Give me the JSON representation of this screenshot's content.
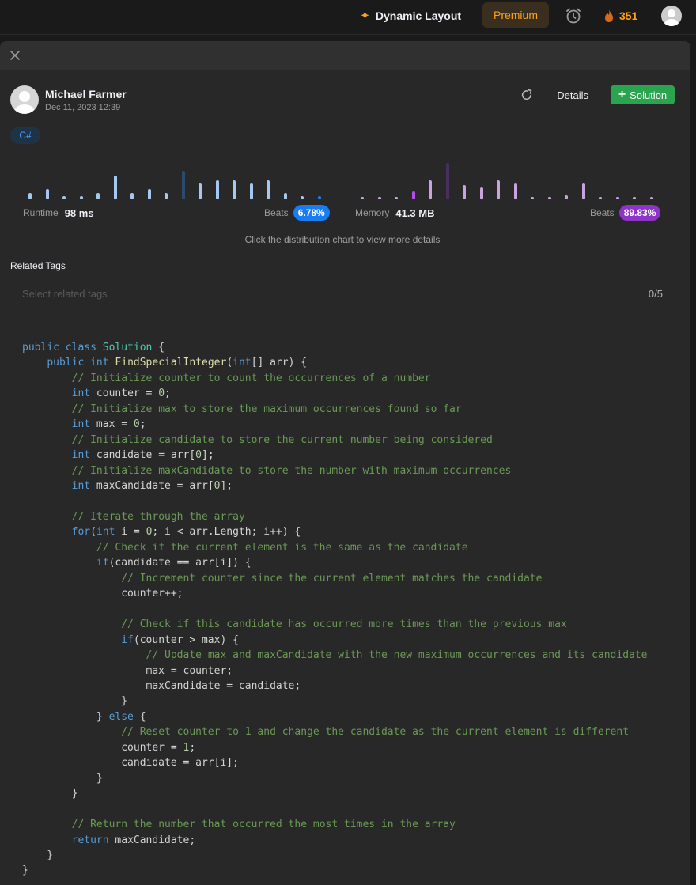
{
  "topbar": {
    "dynamic_layout": "Dynamic Layout",
    "premium": "Premium",
    "streak": "351"
  },
  "submission": {
    "author": "Michael Farmer",
    "date": "Dec 11, 2023 12:39",
    "details_label": "Details",
    "solution_label": "Solution",
    "language": "C#"
  },
  "runtime": {
    "label": "Runtime",
    "value": "98 ms",
    "beats_label": "Beats",
    "beats": "6.78%",
    "accent": "#1a7cf1"
  },
  "memory": {
    "label": "Memory",
    "value": "41.3 MB",
    "beats_label": "Beats",
    "beats": "89.83%",
    "accent": "#8e35c8"
  },
  "hint": "Click the distribution chart to view more details",
  "related_tags": {
    "label": "Related Tags",
    "placeholder": "Select related tags",
    "count": "0/5"
  },
  "code": [
    "public class Solution {",
    "    public int FindSpecialInteger(int[] arr) {",
    "        // Initialize counter to count the occurrences of a number",
    "        int counter = 0;",
    "        // Initialize max to store the maximum occurrences found so far",
    "        int max = 0;",
    "        // Initialize candidate to store the current number being considered",
    "        int candidate = arr[0];",
    "        // Initialize maxCandidate to store the number with maximum occurrences",
    "        int maxCandidate = arr[0];",
    "",
    "        // Iterate through the array",
    "        for(int i = 0; i < arr.Length; i++) {",
    "            // Check if the current element is the same as the candidate",
    "            if(candidate == arr[i]) {",
    "                // Increment counter since the current element matches the candidate",
    "                counter++;",
    "",
    "                // Check if this candidate has occurred more times than the previous max",
    "                if(counter > max) {",
    "                    // Update max and maxCandidate with the new maximum occurrences and its candidate",
    "                    max = counter;",
    "                    maxCandidate = candidate;",
    "                }",
    "            } else {",
    "                // Reset counter to 1 and change the candidate as the current element is different",
    "                counter = 1;",
    "                candidate = arr[i];",
    "            }",
    "        }",
    "",
    "        // Return the number that occurred the most times in the array",
    "        return maxCandidate;",
    "    }",
    "}"
  ]
}
